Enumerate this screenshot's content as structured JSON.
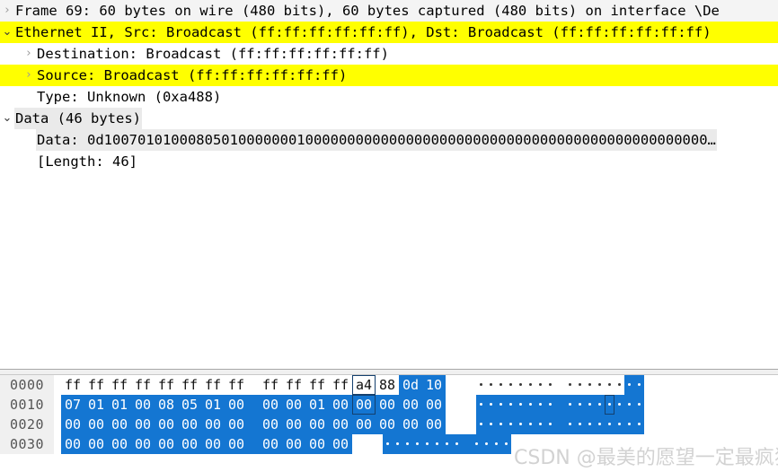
{
  "detail_tree": {
    "rows": [
      {
        "twisty": "collapsed",
        "indent": 0,
        "text": "Frame 69: 60 bytes on wire (480 bits), 60 bytes captured (480 bits) on interface \\De",
        "row_bg": "pale",
        "label_bg": "none"
      },
      {
        "twisty": "expanded",
        "indent": 0,
        "text": "Ethernet II, Src: Broadcast (ff:ff:ff:ff:ff:ff), Dst: Broadcast (ff:ff:ff:ff:ff:ff)",
        "row_bg": "yellow",
        "label_bg": "none"
      },
      {
        "twisty": "collapsed",
        "indent": 1,
        "text": "Destination: Broadcast (ff:ff:ff:ff:ff:ff)",
        "row_bg": "none",
        "label_bg": "none"
      },
      {
        "twisty": "collapsed",
        "indent": 1,
        "text": "Source: Broadcast (ff:ff:ff:ff:ff:ff)",
        "row_bg": "yellow",
        "label_bg": "none"
      },
      {
        "twisty": "none",
        "indent": 1,
        "text": "Type: Unknown (0xa488)",
        "row_bg": "none",
        "label_bg": "none"
      },
      {
        "twisty": "expanded",
        "indent": 0,
        "text": "Data (46 bytes)",
        "row_bg": "none",
        "label_bg": "gray"
      },
      {
        "twisty": "none",
        "indent": 1,
        "text": "Data: 0d100701010008050100000001000000000000000000000000000000000000000000000000…",
        "row_bg": "none",
        "label_bg": "gray"
      },
      {
        "twisty": "none",
        "indent": 1,
        "text": "[Length: 46]",
        "row_bg": "none",
        "label_bg": "none"
      }
    ]
  },
  "bytes_pane": {
    "rows": [
      {
        "offset": "0000",
        "bytes": [
          "ff",
          "ff",
          "ff",
          "ff",
          "ff",
          "ff",
          "ff",
          "ff",
          "ff",
          "ff",
          "ff",
          "ff",
          "a4",
          "88",
          "0d",
          "10"
        ],
        "selected": [
          false,
          false,
          false,
          false,
          false,
          false,
          false,
          false,
          false,
          false,
          false,
          false,
          false,
          false,
          true,
          true
        ],
        "cursor_index": 12,
        "ascii": [
          ".",
          ".",
          ".",
          ".",
          ".",
          ".",
          ".",
          ".",
          ".",
          ".",
          ".",
          ".",
          ".",
          ".",
          ".",
          "."
        ],
        "ascii_selected": [
          false,
          false,
          false,
          false,
          false,
          false,
          false,
          false,
          false,
          false,
          false,
          false,
          false,
          false,
          true,
          true
        ],
        "ascii_cursor_index": -1
      },
      {
        "offset": "0010",
        "bytes": [
          "07",
          "01",
          "01",
          "00",
          "08",
          "05",
          "01",
          "00",
          "00",
          "00",
          "01",
          "00",
          "00",
          "00",
          "00",
          "00"
        ],
        "selected": [
          true,
          true,
          true,
          true,
          true,
          true,
          true,
          true,
          true,
          true,
          true,
          true,
          true,
          true,
          true,
          true
        ],
        "cursor_index": 12,
        "ascii": [
          ".",
          ".",
          ".",
          ".",
          ".",
          ".",
          ".",
          ".",
          ".",
          ".",
          ".",
          ".",
          ".",
          ".",
          ".",
          "."
        ],
        "ascii_selected": [
          true,
          true,
          true,
          true,
          true,
          true,
          true,
          true,
          true,
          true,
          true,
          true,
          true,
          true,
          true,
          true
        ],
        "ascii_cursor_index": 12
      },
      {
        "offset": "0020",
        "bytes": [
          "00",
          "00",
          "00",
          "00",
          "00",
          "00",
          "00",
          "00",
          "00",
          "00",
          "00",
          "00",
          "00",
          "00",
          "00",
          "00"
        ],
        "selected": [
          true,
          true,
          true,
          true,
          true,
          true,
          true,
          true,
          true,
          true,
          true,
          true,
          true,
          true,
          true,
          true
        ],
        "cursor_index": -1,
        "ascii": [
          ".",
          ".",
          ".",
          ".",
          ".",
          ".",
          ".",
          ".",
          ".",
          ".",
          ".",
          ".",
          ".",
          ".",
          ".",
          "."
        ],
        "ascii_selected": [
          true,
          true,
          true,
          true,
          true,
          true,
          true,
          true,
          true,
          true,
          true,
          true,
          true,
          true,
          true,
          true
        ],
        "ascii_cursor_index": -1
      },
      {
        "offset": "0030",
        "bytes": [
          "00",
          "00",
          "00",
          "00",
          "00",
          "00",
          "00",
          "00",
          "00",
          "00",
          "00",
          "00"
        ],
        "selected": [
          true,
          true,
          true,
          true,
          true,
          true,
          true,
          true,
          true,
          true,
          true,
          true
        ],
        "cursor_index": -1,
        "ascii": [
          ".",
          ".",
          ".",
          ".",
          ".",
          ".",
          ".",
          ".",
          ".",
          ".",
          ".",
          "."
        ],
        "ascii_selected": [
          true,
          true,
          true,
          true,
          true,
          true,
          true,
          true,
          true,
          true,
          true,
          true
        ],
        "ascii_cursor_index": -1
      }
    ]
  },
  "watermark": {
    "text": "CSDN @最美的愿望一定最疯狂"
  },
  "colors": {
    "highlight_yellow": "#ffff00",
    "selection_blue": "#1476d2",
    "gray_label": "#dcdcdc",
    "offset_bg": "#f0f0f0"
  }
}
